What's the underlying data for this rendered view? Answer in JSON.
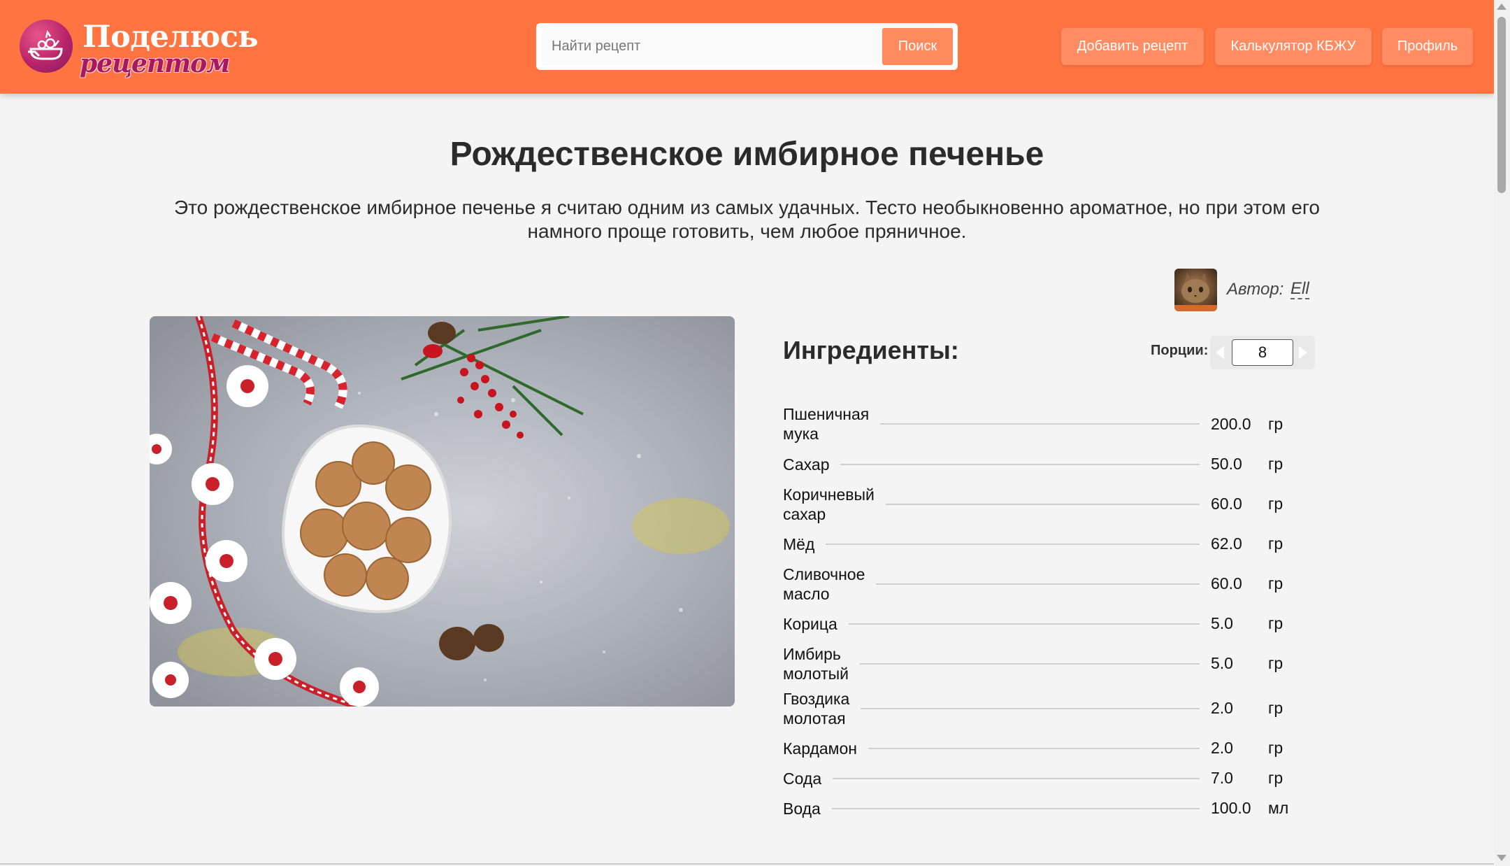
{
  "header": {
    "logo_top": "Поделюсь",
    "logo_bottom": "рецептом",
    "search_placeholder": "Найти рецепт",
    "search_button": "Поиск",
    "nav": {
      "add_recipe": "Добавить рецепт",
      "calculator": "Калькулятор КБЖУ",
      "profile": "Профиль"
    }
  },
  "recipe": {
    "title": "Рождественское имбирное печенье",
    "description": "Это рождественское имбирное печенье я считаю одним из самых удачных. Тесто необыкновенно ароматное, но при этом его намного проще готовить, чем любое пряничное.",
    "author_label": "Автор:",
    "author_name": "Ell"
  },
  "ingredients": {
    "title": "Ингредиенты:",
    "portions_label": "Порции:",
    "portions_value": "8",
    "items": [
      {
        "name_1": "Пшеничная",
        "name_2": "мука",
        "amount": "200.0",
        "unit": "гр"
      },
      {
        "name_1": "Сахар",
        "name_2": "",
        "amount": "50.0",
        "unit": "гр"
      },
      {
        "name_1": "Коричневый",
        "name_2": "сахар",
        "amount": "60.0",
        "unit": "гр"
      },
      {
        "name_1": "Мёд",
        "name_2": "",
        "amount": "62.0",
        "unit": "гр"
      },
      {
        "name_1": "Сливочное",
        "name_2": "масло",
        "amount": "60.0",
        "unit": "гр"
      },
      {
        "name_1": "Корица",
        "name_2": "",
        "amount": "5.0",
        "unit": "гр"
      },
      {
        "name_1": "Имбирь",
        "name_2": "молотый",
        "amount": "5.0",
        "unit": "гр"
      },
      {
        "name_1": "Гвоздика",
        "name_2": "молотая",
        "amount": "2.0",
        "unit": "гр"
      },
      {
        "name_1": "Кардамон",
        "name_2": "",
        "amount": "2.0",
        "unit": "гр"
      },
      {
        "name_1": "Сода",
        "name_2": "",
        "amount": "7.0",
        "unit": "гр"
      },
      {
        "name_1": "Вода",
        "name_2": "",
        "amount": "100.0",
        "unit": "мл"
      }
    ]
  },
  "colors": {
    "header": "#ff7440",
    "button": "#ff8c62",
    "background": "#f4f4f4"
  }
}
